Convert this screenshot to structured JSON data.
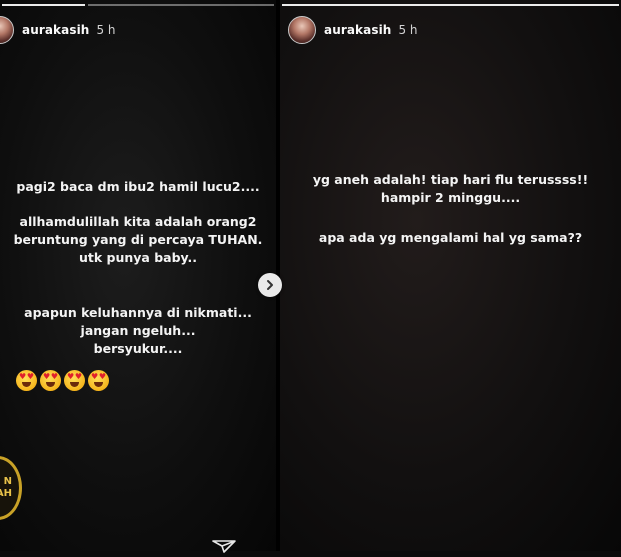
{
  "left_story": {
    "username": "aurakasih",
    "time": "5 h",
    "text_blocks": [
      "pagi2 baca dm ibu2 hamil lucu2....",
      "allhamdulillah kita adalah orang2\nberuntung yang di percaya TUHAN.\nutk punya baby..",
      "apapun keluhannya di nikmati...\njangan ngeluh...\nbersyukur...."
    ],
    "emoji": [
      "smiling-face-with-heart-eyes",
      "smiling-face-with-heart-eyes",
      "smiling-face-with-heart-eyes",
      "smiling-face-with-heart-eyes"
    ],
    "badge_lines": [
      "N",
      "AH"
    ],
    "progress": 0.45
  },
  "right_story": {
    "username": "aurakasih",
    "time": "5 h",
    "text_blocks": [
      "yg aneh adalah! tiap hari flu terussss!!\nhampir 2 minggu....",
      "apa ada yg mengalami hal yg sama??"
    ]
  },
  "icons": {
    "next": "chevron-right-icon",
    "send": "send-icon"
  }
}
